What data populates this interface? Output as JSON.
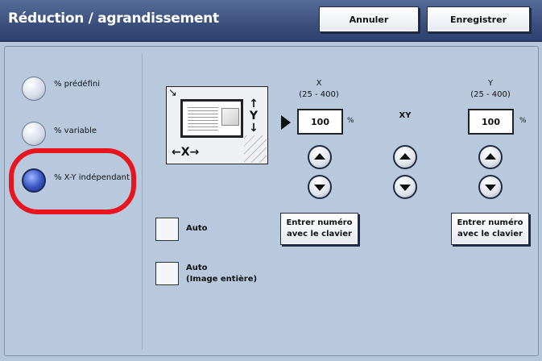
{
  "header": {
    "title": "Réduction / agrandissement",
    "cancel_label": "Annuler",
    "save_label": "Enregistrer"
  },
  "modes": {
    "preset_label": "% prédéfini",
    "variable_label": "% variable",
    "independent_label": "% X-Y indépendant",
    "selected": "% X-Y indépendant"
  },
  "diagram": {
    "y_axis_letter": "Y",
    "x_axis_text": "←X→"
  },
  "x_setting": {
    "axis": "X",
    "range": "(25 - 400)",
    "value": "100",
    "unit": "%"
  },
  "xy_setting": {
    "axis": "XY"
  },
  "y_setting": {
    "axis": "Y",
    "range": "(25 - 400)",
    "value": "100",
    "unit": "%"
  },
  "keypad": {
    "x_label": "Entrer numéro avec le clavier",
    "y_label": "Entrer numéro avec le clavier"
  },
  "options": {
    "auto_label": "Auto",
    "auto_full_label_line1": "Auto",
    "auto_full_label_line2": "(Image entière)"
  },
  "colors": {
    "title_bar": "#3a4f7c",
    "panel": "#b8c9de",
    "highlight": "#e8141e",
    "selected_radio": "#3655c4"
  }
}
